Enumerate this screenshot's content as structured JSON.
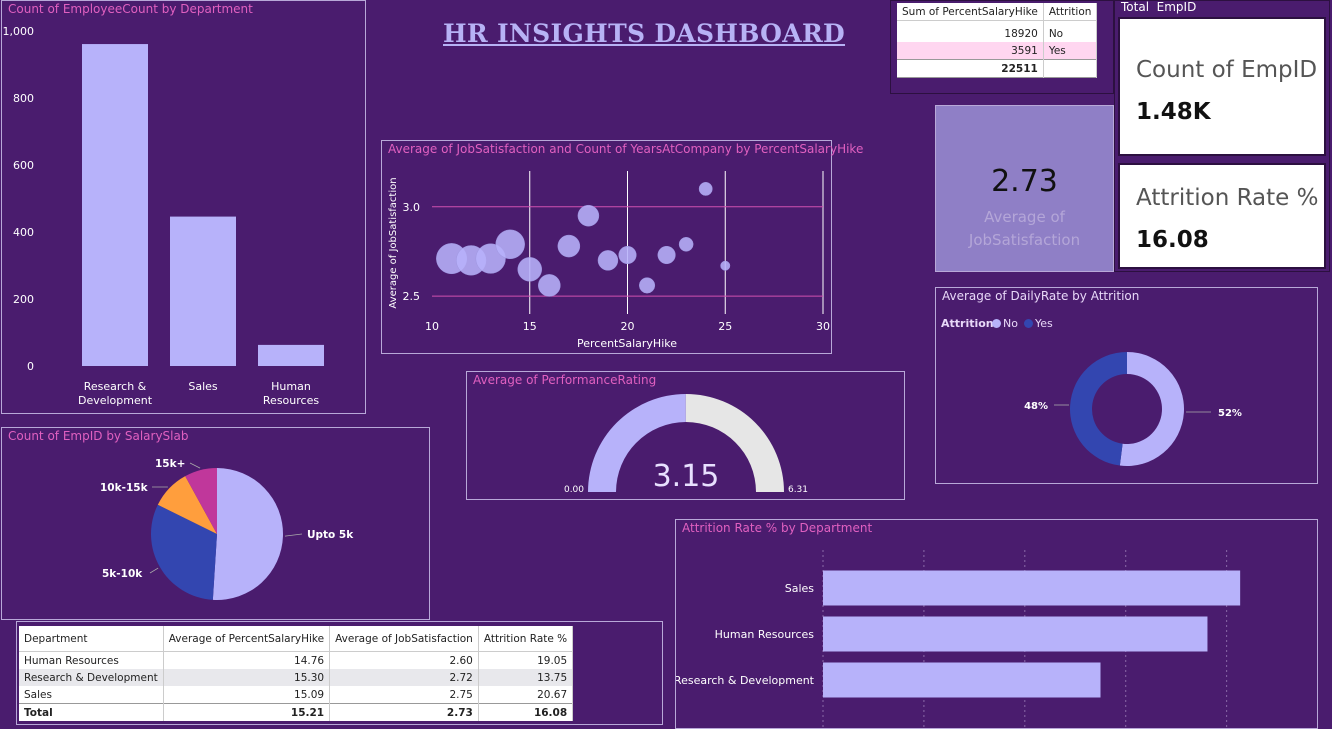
{
  "header": {
    "title": "HR INSIGHTS DASHBOARD"
  },
  "colors": {
    "background": "#4a1c6e",
    "bar": "#b7b2fa",
    "yes": "#3346b0",
    "accent_title": "#e060c0",
    "gauge_empty": "#e6e6e6"
  },
  "dept_chart": {
    "title": "Count of EmployeeCount by Department",
    "chart_data": {
      "type": "bar",
      "categories": [
        [
          "Research &",
          "Development"
        ],
        [
          "Sales"
        ],
        [
          "Human",
          "Resources"
        ]
      ],
      "values": [
        961,
        446,
        63
      ],
      "ylim": [
        0,
        1000
      ],
      "yticks": [
        "0",
        "200",
        "400",
        "600",
        "800",
        "1,000"
      ],
      "title": "Count of EmployeeCount by Department"
    }
  },
  "bubble_chart": {
    "title": "Average of JobSatisfaction and Count of YearsAtCompany by PercentSalaryHike",
    "xlabel": "PercentSalaryHike",
    "ylabel": "Average of JobSatisfaction",
    "chart_data": {
      "type": "scatter",
      "xlim": [
        10,
        30
      ],
      "ylim": [
        2.4,
        3.2
      ],
      "xticks": [
        "10",
        "15",
        "20",
        "25"
      ],
      "xticks_right": "30",
      "yticks": [
        "2.5",
        "3.0"
      ],
      "points": [
        {
          "x": 11,
          "y": 2.71,
          "size": 210
        },
        {
          "x": 12,
          "y": 2.7,
          "size": 200
        },
        {
          "x": 13,
          "y": 2.71,
          "size": 200
        },
        {
          "x": 14,
          "y": 2.79,
          "size": 190
        },
        {
          "x": 15,
          "y": 2.65,
          "size": 130
        },
        {
          "x": 16,
          "y": 2.56,
          "size": 110
        },
        {
          "x": 17,
          "y": 2.78,
          "size": 110
        },
        {
          "x": 18,
          "y": 2.95,
          "size": 100
        },
        {
          "x": 19,
          "y": 2.7,
          "size": 90
        },
        {
          "x": 20,
          "y": 2.73,
          "size": 70
        },
        {
          "x": 21,
          "y": 2.56,
          "size": 55
        },
        {
          "x": 22,
          "y": 2.73,
          "size": 70
        },
        {
          "x": 23,
          "y": 2.79,
          "size": 45
        },
        {
          "x": 24,
          "y": 3.1,
          "size": 40
        },
        {
          "x": 25,
          "y": 2.67,
          "size": 20
        }
      ]
    }
  },
  "gauge": {
    "title": "Average of PerformanceRating",
    "value": "3.15",
    "value_num": 3.15,
    "min": "0.00",
    "max": "6.31",
    "max_num": 6.31
  },
  "avg_card": {
    "value": "2.73",
    "label_line1": "Average of",
    "label_line2": "JobSatisfaction"
  },
  "pie": {
    "title": "Count of EmpID by SalarySlab",
    "chart_data": {
      "type": "pie",
      "slices": [
        {
          "label": "Upto 5k",
          "value": 51.0,
          "color": "#b7b2fa"
        },
        {
          "label": "5k-10k",
          "value": 31.3,
          "color": "#3346b0"
        },
        {
          "label": "10k-15k",
          "value": 9.7,
          "color": "#ff9e3d"
        },
        {
          "label": "15k+",
          "value": 8.0,
          "color": "#c0379b"
        }
      ]
    }
  },
  "donut": {
    "title": "Average of DailyRate by Attrition",
    "legend_title": "Attrition",
    "chart_data": {
      "type": "pie",
      "slices": [
        {
          "label": "No",
          "value": 52,
          "value_label": "52%",
          "color": "#b7b2fa"
        },
        {
          "label": "Yes",
          "value": 48,
          "value_label": "48%",
          "color": "#3346b0"
        }
      ]
    }
  },
  "attr_chart": {
    "title": "Attrition Rate % by Department",
    "chart_data": {
      "type": "bar",
      "orientation": "horizontal",
      "categories": [
        "Sales",
        "Human Resources",
        "Research & Development"
      ],
      "values": [
        20.67,
        19.05,
        13.75
      ],
      "xlim": [
        0,
        22
      ]
    }
  },
  "salary_table": {
    "headers": [
      "Sum of PercentSalaryHike",
      "Attrition"
    ],
    "rows": [
      [
        "18920",
        "No"
      ],
      [
        "3591",
        "Yes"
      ]
    ],
    "total": "22511"
  },
  "cards": {
    "count_title": "Total  EmpID",
    "count_label": "Count of EmpID",
    "count_value": "1.48K",
    "attr_label": "Attrition Rate %",
    "attr_value": "16.08"
  },
  "dept_table": {
    "headers": [
      "Department",
      "Average of PercentSalaryHike",
      "Average of JobSatisfaction",
      "Attrition Rate %"
    ],
    "rows": [
      [
        "Human Resources",
        "14.76",
        "2.60",
        "19.05"
      ],
      [
        "Research & Development",
        "15.30",
        "2.72",
        "13.75"
      ],
      [
        "Sales",
        "15.09",
        "2.75",
        "20.67"
      ]
    ],
    "total": [
      "Total",
      "15.21",
      "2.73",
      "16.08"
    ]
  }
}
